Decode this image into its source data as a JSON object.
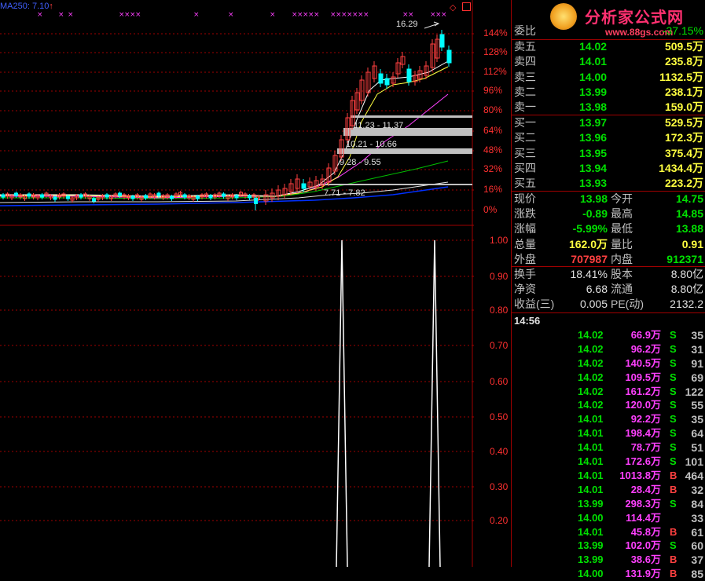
{
  "top_indicator": {
    "label": "MA250: 7.10",
    "arrow": "↑"
  },
  "watermark": {
    "brand": "分析家公式网",
    "url": "www.88gs.com"
  },
  "price_axis": [
    "144%",
    "128%",
    "112%",
    "96%",
    "80%",
    "64%",
    "48%",
    "32%",
    "16%",
    "0%"
  ],
  "indicator_axis": [
    "1.00",
    "0.90",
    "0.80",
    "0.70",
    "0.60",
    "0.50",
    "0.40",
    "0.30",
    "0.20"
  ],
  "chart_annotations": {
    "high_label": "16.29",
    "zones": [
      "11.23 - 11.37",
      "10.21 - 10.66",
      "9.28 - 9.55",
      "7.71 - 7.82"
    ]
  },
  "order_book": {
    "header": "委比",
    "header_value": "-37.15%",
    "asks": [
      {
        "label": "卖五",
        "price": "14.02",
        "vol": "509.5万"
      },
      {
        "label": "卖四",
        "price": "14.01",
        "vol": "235.8万"
      },
      {
        "label": "卖三",
        "price": "14.00",
        "vol": "1132.5万"
      },
      {
        "label": "卖二",
        "price": "13.99",
        "vol": "238.1万"
      },
      {
        "label": "卖一",
        "price": "13.98",
        "vol": "159.0万"
      }
    ],
    "bids": [
      {
        "label": "买一",
        "price": "13.97",
        "vol": "529.5万"
      },
      {
        "label": "买二",
        "price": "13.96",
        "vol": "172.3万"
      },
      {
        "label": "买三",
        "price": "13.95",
        "vol": "375.4万"
      },
      {
        "label": "买四",
        "price": "13.94",
        "vol": "1434.4万"
      },
      {
        "label": "买五",
        "price": "13.93",
        "vol": "223.2万"
      }
    ]
  },
  "quote": [
    {
      "l1": "现价",
      "v1": "13.98",
      "l2": "今开",
      "v2": "14.75"
    },
    {
      "l1": "涨跌",
      "v1": "-0.89",
      "l2": "最高",
      "v2": "14.85"
    },
    {
      "l1": "涨幅",
      "v1": "-5.99%",
      "l2": "最低",
      "v2": "13.88"
    },
    {
      "l1": "总量",
      "v1": "162.0万",
      "l2": "量比",
      "v2": "0.91"
    },
    {
      "l1": "外盘",
      "v1": "707987",
      "l2": "内盘",
      "v2": "912371"
    }
  ],
  "fundamentals": [
    {
      "l1": "换手",
      "v1": "18.41%",
      "l2": "股本",
      "v2": "8.80亿"
    },
    {
      "l1": "净资",
      "v1": "6.68",
      "l2": "流通",
      "v2": "8.80亿"
    },
    {
      "l1": "收益(三)",
      "v1": "0.005",
      "l2": "PE(动)",
      "v2": "2132.2"
    }
  ],
  "ticks": {
    "time": "14:56",
    "rows": [
      {
        "price": "14.02",
        "amount": "66.9万",
        "side": "S",
        "count": "35"
      },
      {
        "price": "14.02",
        "amount": "96.2万",
        "side": "S",
        "count": "31"
      },
      {
        "price": "14.02",
        "amount": "140.5万",
        "side": "S",
        "count": "91"
      },
      {
        "price": "14.02",
        "amount": "109.5万",
        "side": "S",
        "count": "69"
      },
      {
        "price": "14.02",
        "amount": "161.2万",
        "side": "S",
        "count": "122"
      },
      {
        "price": "14.02",
        "amount": "120.0万",
        "side": "S",
        "count": "55"
      },
      {
        "price": "14.01",
        "amount": "92.2万",
        "side": "S",
        "count": "35"
      },
      {
        "price": "14.01",
        "amount": "198.4万",
        "side": "S",
        "count": "64"
      },
      {
        "price": "14.01",
        "amount": "78.7万",
        "side": "S",
        "count": "51"
      },
      {
        "price": "14.01",
        "amount": "172.6万",
        "side": "S",
        "count": "101"
      },
      {
        "price": "14.01",
        "amount": "1013.8万",
        "side": "B",
        "count": "464"
      },
      {
        "price": "14.01",
        "amount": "28.4万",
        "side": "B",
        "count": "32"
      },
      {
        "price": "13.99",
        "amount": "298.3万",
        "side": "S",
        "count": "84"
      },
      {
        "price": "14.00",
        "amount": "114.4万",
        "side": "",
        "count": "33"
      },
      {
        "price": "14.01",
        "amount": "45.8万",
        "side": "B",
        "count": "61"
      },
      {
        "price": "13.99",
        "amount": "102.0万",
        "side": "S",
        "count": "60"
      },
      {
        "price": "13.99",
        "amount": "38.6万",
        "side": "B",
        "count": "37"
      },
      {
        "price": "14.00",
        "amount": "131.9万",
        "side": "B",
        "count": "85"
      }
    ]
  },
  "colors": {
    "up": "#ff4040",
    "down": "#00ffff",
    "grid": "#a00000",
    "ma5": "#ffffff",
    "ma10": "#ffff60",
    "ma20": "#ff40ff",
    "ma60": "#00d000",
    "ma120": "#ffffff",
    "ma250": "#0000ff"
  }
}
